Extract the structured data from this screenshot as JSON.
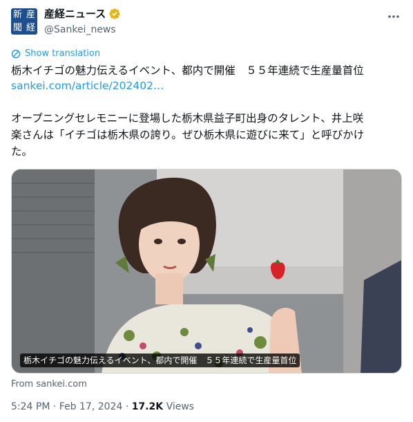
{
  "account": {
    "display_name": "産経ニュース",
    "handle": "@Sankei_news",
    "avatar_chars": [
      "産",
      "経",
      "新",
      "聞"
    ]
  },
  "more_icon": "more-horizontal-icon",
  "translate": {
    "label": "Show translation",
    "icon": "translate-icon"
  },
  "tweet": {
    "line1": "栃木イチゴの魅力伝えるイベント、都内で開催　５５年連続で生産量首位",
    "link": "sankei.com/article/202402…",
    "para2_lines": [
      "オープニングセレモニーに登場した栃木県益子町出身のタレント、井上咲",
      "楽さんは「イチゴは栃木県の誇り。ぜひ栃木県に遊びに来て」と呼びかけ",
      "た。"
    ]
  },
  "card": {
    "caption": "栃木イチゴの魅力伝えるイベント、都内で開催　５５年連続で生産量首位",
    "source": "From sankei.com"
  },
  "meta": {
    "time": "5:24 PM",
    "separator": "·",
    "date": "Feb 17, 2024",
    "views_count": "17.2K",
    "views_label": "Views"
  },
  "colors": {
    "accent": "#1d9bf0",
    "verified": "#e2b719",
    "muted": "#536471",
    "avatar_bg": "#1d4e8f"
  }
}
